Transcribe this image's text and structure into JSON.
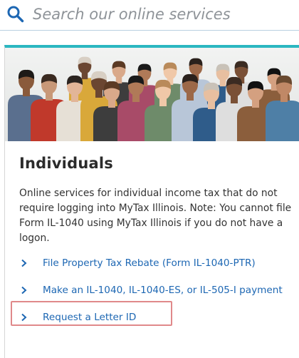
{
  "search": {
    "placeholder": "Search our online services",
    "icon": "search-icon"
  },
  "colors": {
    "accent_bar": "#2bb7c1",
    "link": "#1d67b3",
    "highlight_border": "#e0898a",
    "search_icon": "#1d67b3"
  },
  "card": {
    "title": "Individuals",
    "description": "Online services for individual income tax that do not require logging into MyTax Illinois. Note: You cannot file Form IL-1040 using MyTax Illinois if you do not have a logon.",
    "links": [
      {
        "label": "File Property Tax Rebate (Form IL-1040-PTR)",
        "icon": "chevron-right-icon"
      },
      {
        "label": "Make an IL-1040, IL-1040-ES, or IL-505-I payment",
        "icon": "chevron-right-icon"
      },
      {
        "label": "Request a Letter ID",
        "icon": "chevron-right-icon",
        "highlighted": true
      }
    ]
  }
}
